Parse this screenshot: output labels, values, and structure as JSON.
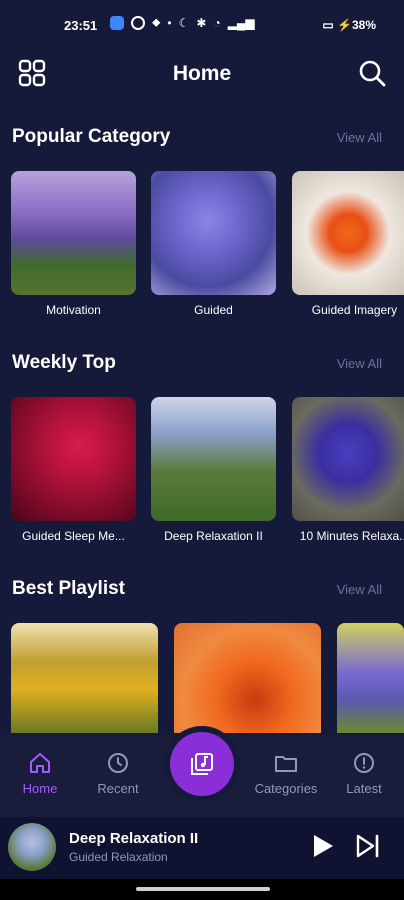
{
  "status_bar": {
    "time": "23:51",
    "battery": "38%"
  },
  "header": {
    "title": "Home"
  },
  "sections": {
    "popular": {
      "title": "Popular Category",
      "view_all": "View All",
      "items": [
        {
          "label": "Motivation"
        },
        {
          "label": "Guided"
        },
        {
          "label": "Guided Imagery"
        }
      ]
    },
    "weekly": {
      "title": "Weekly Top",
      "view_all": "View All",
      "items": [
        {
          "label": "Guided Sleep Me..."
        },
        {
          "label": "Deep Relaxation II"
        },
        {
          "label": "10 Minutes Relaxa..."
        }
      ]
    },
    "playlist": {
      "title": "Best Playlist",
      "view_all": "View All"
    }
  },
  "nav": {
    "home": "Home",
    "recent": "Recent",
    "categories": "Categories",
    "latest": "Latest"
  },
  "player": {
    "title": "Deep Relaxation II",
    "subtitle": "Guided Relaxation"
  },
  "colors": {
    "background": "#161a3a",
    "accent": "#8a2fd8",
    "nav_active": "#a15cff"
  },
  "icons": [
    "grid-icon",
    "search-icon",
    "home-icon",
    "history-icon",
    "music-library-icon",
    "folder-icon",
    "latest-icon",
    "play-icon",
    "skip-next-icon"
  ]
}
